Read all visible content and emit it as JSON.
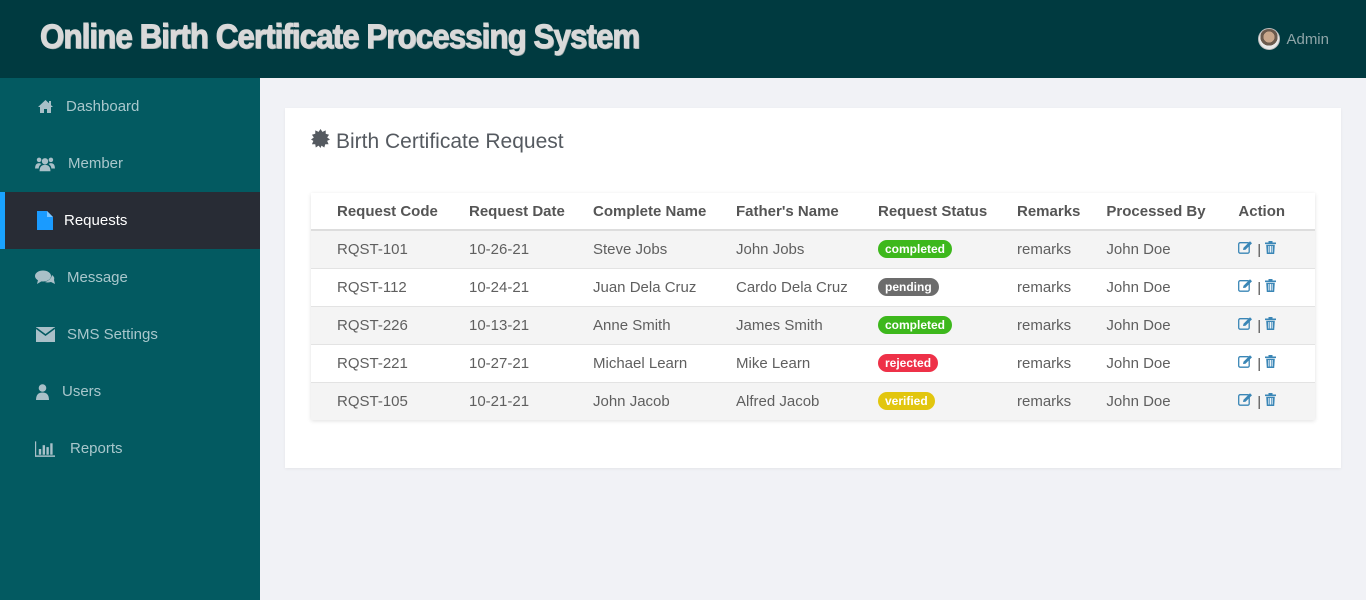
{
  "header": {
    "app_title": "Online Birth Certificate Processing System",
    "user_name": "Admin",
    "avatar_icon": "user-avatar"
  },
  "sidebar": {
    "items": [
      {
        "label": "Dashboard",
        "icon": "home-icon",
        "active": false
      },
      {
        "label": "Member",
        "icon": "users-icon",
        "active": false
      },
      {
        "label": "Requests",
        "icon": "file-icon",
        "active": true
      },
      {
        "label": "Message",
        "icon": "comments-icon",
        "active": false
      },
      {
        "label": "SMS Settings",
        "icon": "envelope-icon",
        "active": false
      },
      {
        "label": "Users",
        "icon": "user-icon",
        "active": false
      },
      {
        "label": "Reports",
        "icon": "bar-chart-icon",
        "active": false
      }
    ]
  },
  "main": {
    "title": "Birth Certificate Request",
    "title_icon": "certificate-icon",
    "table": {
      "columns": [
        "Request Code",
        "Request Date",
        "Complete Name",
        "Father's Name",
        "Request Status",
        "Remarks",
        "Processed By",
        "Action"
      ],
      "rows": [
        {
          "code": "RQST-101",
          "date": "10-26-21",
          "name": "Steve Jobs",
          "father": "John Jobs",
          "status": "completed",
          "remarks": "remarks",
          "processed_by": "John Doe"
        },
        {
          "code": "RQST-112",
          "date": "10-24-21",
          "name": "Juan Dela Cruz",
          "father": "Cardo Dela Cruz",
          "status": "pending",
          "remarks": "remarks",
          "processed_by": "John Doe"
        },
        {
          "code": "RQST-226",
          "date": "10-13-21",
          "name": "Anne Smith",
          "father": "James Smith",
          "status": "completed",
          "remarks": "remarks",
          "processed_by": "John Doe"
        },
        {
          "code": "RQST-221",
          "date": "10-27-21",
          "name": "Michael Learn",
          "father": "Mike Learn",
          "status": "rejected",
          "remarks": "remarks",
          "processed_by": "John Doe"
        },
        {
          "code": "RQST-105",
          "date": "10-21-21",
          "name": "John Jacob",
          "father": "Alfred Jacob",
          "status": "verified",
          "remarks": "remarks",
          "processed_by": "John Doe"
        }
      ],
      "action_separator": "|"
    }
  },
  "colors": {
    "topbar": "#003a40",
    "sidebar": "#035a61",
    "active_item": "#282c35",
    "active_accent": "#1aa3ff",
    "status_completed": "#3db81c",
    "status_pending": "#6c6c6c",
    "status_rejected": "#ee3148",
    "status_verified": "#e2c60e",
    "action_icon": "#3a86b6"
  }
}
